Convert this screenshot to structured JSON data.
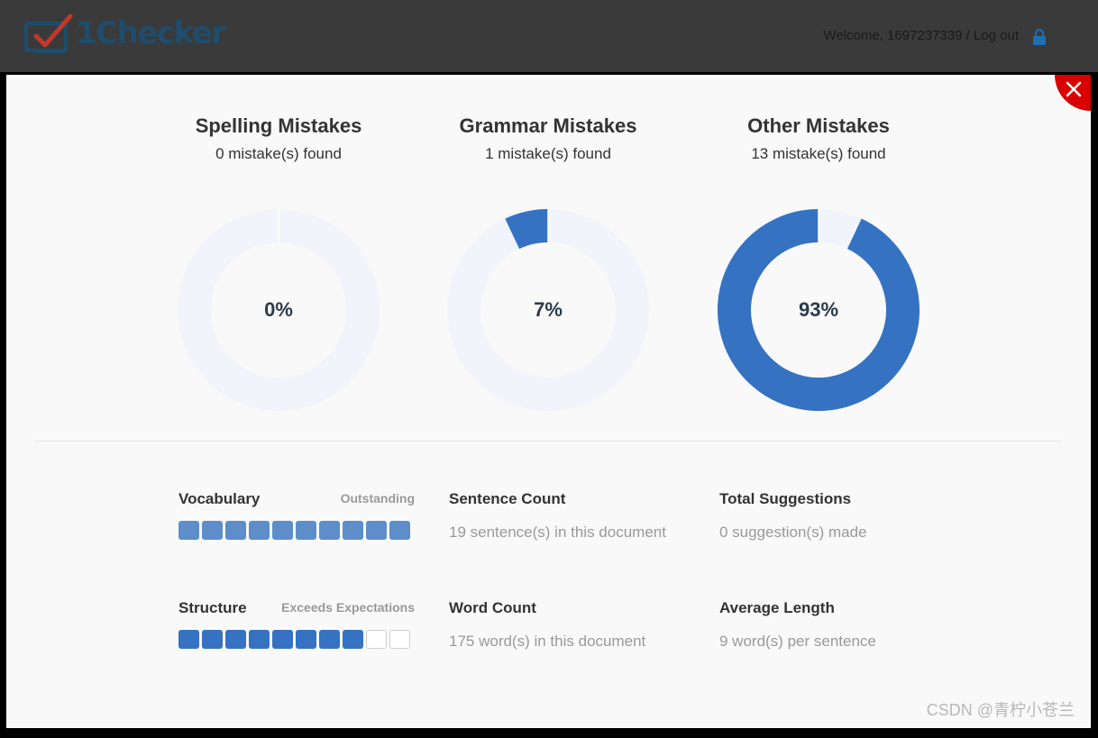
{
  "header": {
    "brand": "1Checker",
    "welcome_text": "Welcome, 1697237339 / Log out",
    "icons": {
      "logo": "checkbox-logo-icon",
      "lock": "lock-icon",
      "close": "close-icon"
    }
  },
  "colors": {
    "accent": "#3572c2",
    "ring_bg": "#f1f5fb",
    "close_red": "#d80000",
    "topbar": "#3a3a3a"
  },
  "summary": [
    {
      "title": "Spelling Mistakes",
      "subtitle": "0 mistake(s) found",
      "percent_label": "0%",
      "percent": 0
    },
    {
      "title": "Grammar Mistakes",
      "subtitle": "1 mistake(s) found",
      "percent_label": "7%",
      "percent": 7
    },
    {
      "title": "Other Mistakes",
      "subtitle": "13 mistake(s) found",
      "percent_label": "93%",
      "percent": 93
    }
  ],
  "metrics": {
    "vocabulary": {
      "label": "Vocabulary",
      "rating": "Outstanding",
      "level": 10,
      "max": 10
    },
    "structure": {
      "label": "Structure",
      "rating": "Exceeds Expectations",
      "level": 8,
      "max": 10
    },
    "sentence_count": {
      "label": "Sentence Count",
      "value": "19 sentence(s) in this document"
    },
    "word_count": {
      "label": "Word Count",
      "value": "175 word(s) in this document"
    },
    "total_suggestions": {
      "label": "Total Suggestions",
      "value": "0 suggestion(s) made"
    },
    "average_length": {
      "label": "Average Length",
      "value": "9 word(s) per sentence"
    }
  },
  "watermark": "CSDN @青柠小苍兰"
}
